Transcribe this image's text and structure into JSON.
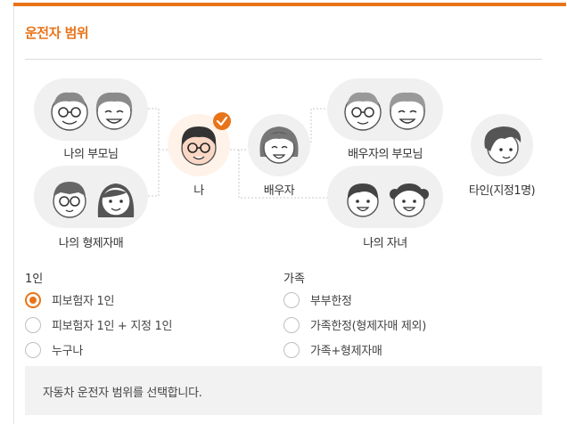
{
  "section": {
    "title": "운전자 범위"
  },
  "diagram": {
    "my_parents": "나의 부모님",
    "my_siblings": "나의 형제자매",
    "me": "나",
    "spouse": "배우자",
    "spouse_parents": "배우자의 부모님",
    "my_children": "나의 자녀",
    "other_person": "타인(지정1명)"
  },
  "options": {
    "single": {
      "title": "1인",
      "items": [
        {
          "label": "피보험자 1인",
          "selected": true
        },
        {
          "label": "피보험자 1인 + 지정 1인",
          "selected": false
        },
        {
          "label": "누구나",
          "selected": false
        }
      ]
    },
    "family": {
      "title": "가족",
      "items": [
        {
          "label": "부부한정",
          "selected": false
        },
        {
          "label": "가족한정(형제자매 제외)",
          "selected": false
        },
        {
          "label": "가족+형제자매",
          "selected": false
        }
      ]
    }
  },
  "notice": {
    "text": "자동차 운전자 범위를 선택합니다."
  },
  "colors": {
    "accent": "#e8741a",
    "blob_bg": "#f0f0f0",
    "me_bg": "#fff2e8",
    "notice_bg": "#f2f2f2"
  }
}
